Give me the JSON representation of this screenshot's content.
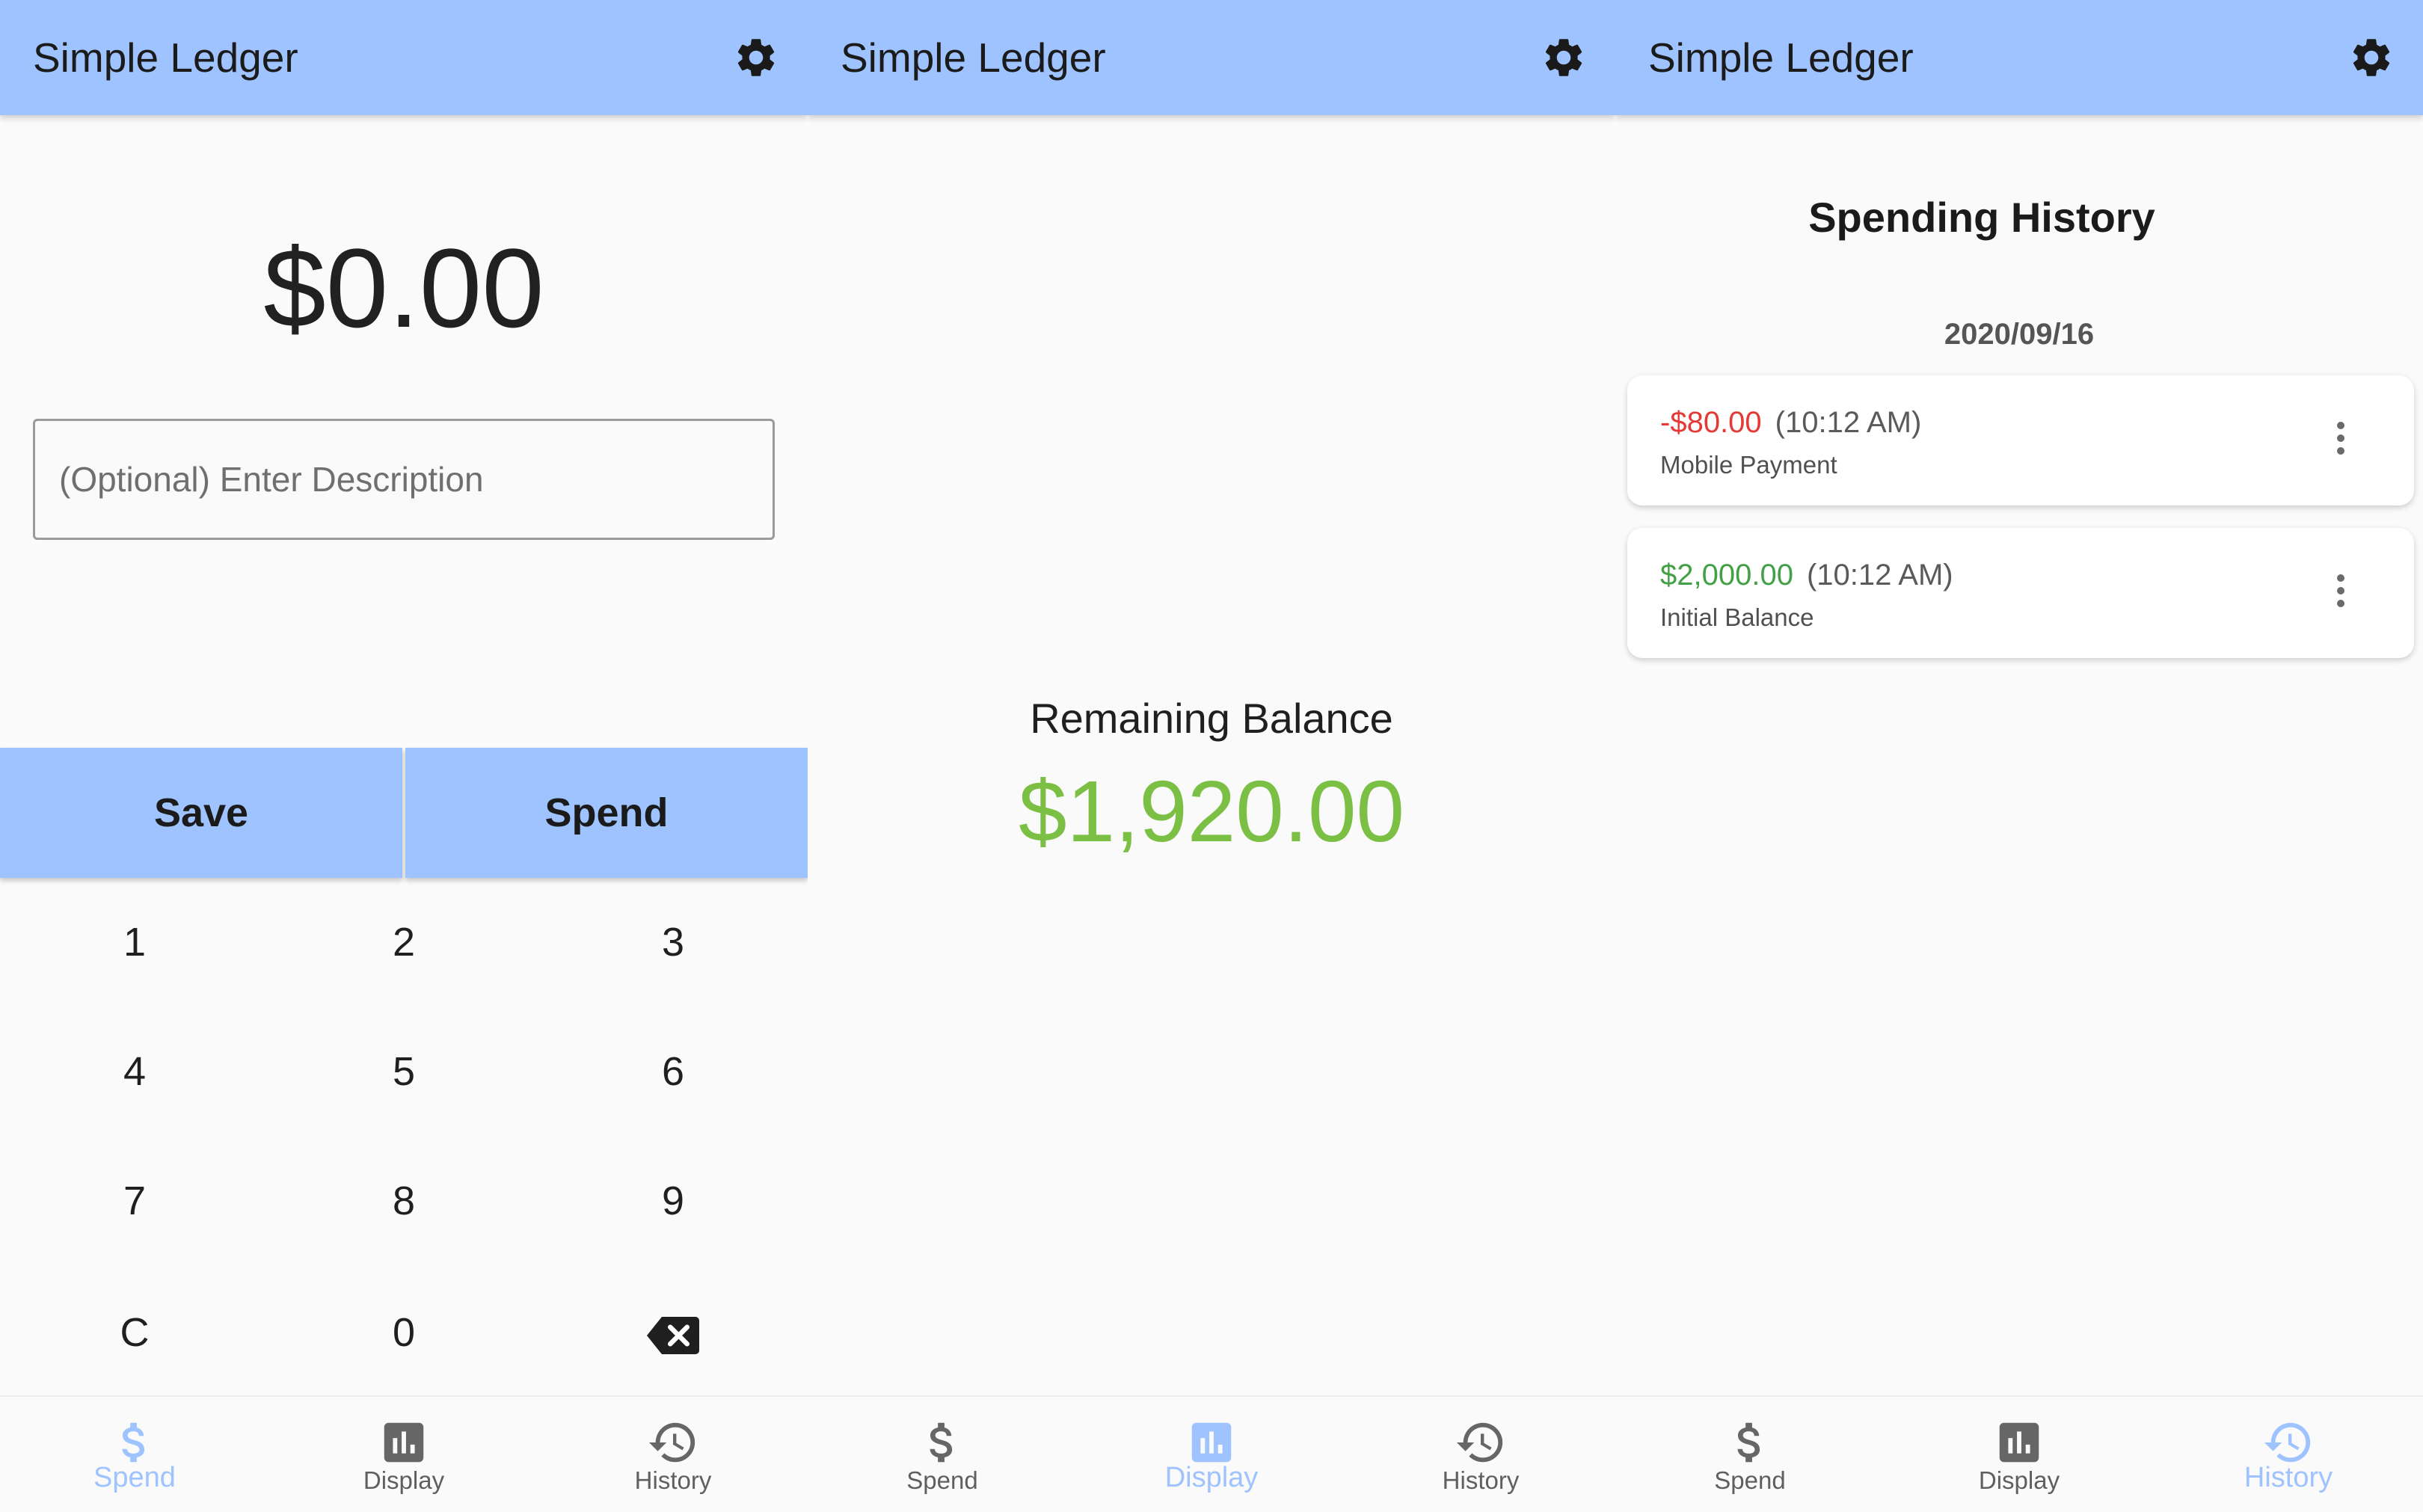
{
  "app": {
    "title": "Simple Ledger"
  },
  "colors": {
    "accent": "#9ec3ff",
    "positive": "#43a047",
    "negative": "#e53935",
    "balance": "#7bbf45"
  },
  "spend": {
    "amount": "$0.00",
    "description_placeholder": "(Optional) Enter Description",
    "description_value": "",
    "save_label": "Save",
    "spend_label": "Spend",
    "keypad": [
      "1",
      "2",
      "3",
      "4",
      "5",
      "6",
      "7",
      "8",
      "9",
      "C",
      "0",
      "backspace-icon"
    ]
  },
  "display": {
    "label": "Remaining Balance",
    "balance": "$1,920.00"
  },
  "history": {
    "title": "Spending History",
    "date": "2020/09/16",
    "entries": [
      {
        "amount": "-$80.00",
        "time": "(10:12 AM)",
        "description": "Mobile Payment",
        "type": "negative"
      },
      {
        "amount": "$2,000.00",
        "time": "(10:12 AM)",
        "description": "Initial Balance",
        "type": "positive"
      }
    ]
  },
  "nav": {
    "items": [
      {
        "label": "Spend",
        "icon": "dollar-icon"
      },
      {
        "label": "Display",
        "icon": "bar-chart-icon"
      },
      {
        "label": "History",
        "icon": "history-icon"
      }
    ],
    "active_per_screen": [
      "Spend",
      "Display",
      "History"
    ]
  }
}
